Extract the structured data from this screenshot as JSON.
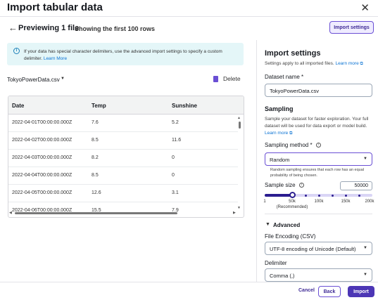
{
  "header": {
    "title": "Import tabular data",
    "close_icon": "close-icon"
  },
  "subbar": {
    "back_icon": "arrow-left-icon",
    "title": "Previewing 1 file",
    "note": "Showing the first 100 rows",
    "advanced_button": "Import settings"
  },
  "info": {
    "icon": "info-icon",
    "text": "If your data has special character delimiters, use the advanced import settings to specify a custom delimiter.",
    "link": "Learn More"
  },
  "file": {
    "name": "TokyoPowerData.csv",
    "caret_icon": "caret-down-icon",
    "delete_icon": "trash-icon",
    "delete_label": "Delete"
  },
  "table": {
    "columns": [
      "Date",
      "Temp",
      "Sunshine"
    ],
    "rows": [
      [
        "2022-04-01T00:00:00.000Z",
        "7.6",
        "5.2"
      ],
      [
        "2022-04-02T00:00:00.000Z",
        "8.5",
        "11.6"
      ],
      [
        "2022-04-03T00:00:00.000Z",
        "8.2",
        "0"
      ],
      [
        "2022-04-04T00:00:00.000Z",
        "8.5",
        "0"
      ],
      [
        "2022-04-05T00:00:00.000Z",
        "12.6",
        "3.1"
      ],
      [
        "2022-04-06T00:00:00.000Z",
        "15.5",
        "7.9"
      ]
    ]
  },
  "settings": {
    "title": "Import settings",
    "apply_text": "Settings apply to all imported files.",
    "learn_more": "Learn more",
    "dataset_label": "Dataset name *",
    "dataset_value": "TokyoPowerData.csv",
    "sampling_title": "Sampling",
    "sampling_help": "Sample your dataset for faster exploration. Your full dataset will be used for data export or model build.",
    "sampling_learn": "Learn more",
    "method_label": "Sampling method *",
    "method_value": "Random",
    "method_help": "Random sampling ensures that each row has an equal probability of being chosen.",
    "size_label": "Sample size",
    "size_value": "50000",
    "slider_value": 50000,
    "ticks": [
      "1",
      "50k",
      "100k",
      "150k",
      "200k"
    ],
    "tick_note": "(Recommended)",
    "advanced_title": "Advanced",
    "encoding_label": "File Encoding (CSV)",
    "encoding_value": "UTF-8 encoding of Unicode (Default)",
    "delimiter_label": "Delimiter",
    "delimiter_value": "Comma (,)"
  },
  "footer": {
    "cancel": "Cancel",
    "back": "Back",
    "import": "Import"
  },
  "colors": {
    "accent": "#4c36b5",
    "info_bg": "#e4f6f8",
    "link": "#0972d3"
  }
}
